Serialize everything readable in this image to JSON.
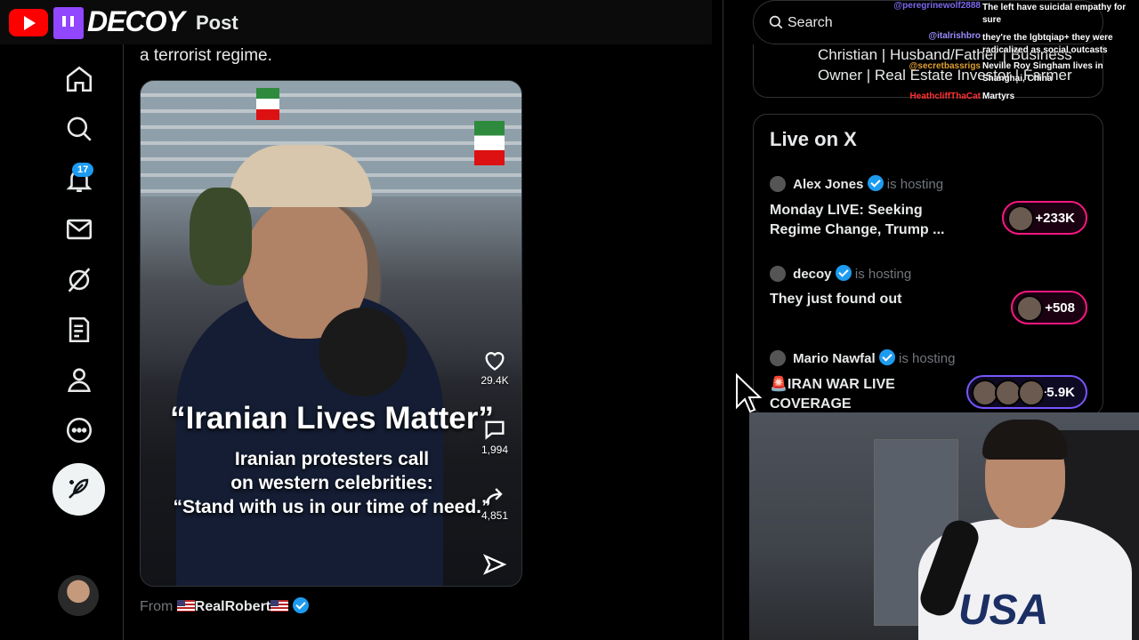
{
  "stream": {
    "channel_name": "DECOY"
  },
  "header": {
    "title": "Post"
  },
  "nav": {
    "notifications_badge": "17",
    "items": [
      "home-icon",
      "search-icon",
      "notifications-icon",
      "messages-icon",
      "grok-icon",
      "articles-icon",
      "profile-icon",
      "more-icon"
    ]
  },
  "post": {
    "text_fragment": "a terrorist regime.",
    "video": {
      "caption_title": "“Iranian Lives Matter”",
      "caption_line1": "Iranian protesters call",
      "caption_line2": "on western celebrities:",
      "caption_line3": "“Stand with us in our time of need.”",
      "likes": "29.4K",
      "comments": "1,994",
      "shares": "4,851"
    },
    "from_label": "From",
    "from_user": "RealRobert"
  },
  "search": {
    "placeholder": "Search"
  },
  "bio_card": {
    "line1": "Christian | Husband/Father | Business",
    "line2": "Owner | Real Estate Investor | Farmer"
  },
  "live": {
    "title": "Live on X",
    "hosting_label": "is hosting",
    "items": [
      {
        "host": "Alex Jones",
        "title_line1": "Monday LIVE: Seeking",
        "title_line2": "Regime Change, Trump ...",
        "listeners": "+233K"
      },
      {
        "host": "decoy",
        "title_line1": "They just found out",
        "title_line2": "",
        "listeners": "+508"
      },
      {
        "host": "Mario Nawfal",
        "title_line1": "🚨IRAN WAR LIVE",
        "title_line2": "COVERAGE",
        "listeners": "+5.9K"
      }
    ]
  },
  "chat": [
    {
      "user": "@peregrinewolf2888",
      "message": "The left have suicidal empathy for sure",
      "color": "#7b68ee"
    },
    {
      "user": "@italrishbro",
      "message": "they're the lgbtqiap+ they were radicalized as social outcasts",
      "color": "#9b8cff"
    },
    {
      "user": "@secretbassrigs",
      "message": "Neville Roy Singham lives in Shanghai, China",
      "color": "#e0a030"
    },
    {
      "user": "HeathcliffThaCat",
      "message": "Martyrs",
      "color": "#ff3030"
    }
  ],
  "colors": {
    "accent_blue": "#1d9bf0",
    "live_pink": "#f91880",
    "live_purple": "#7856ff"
  }
}
